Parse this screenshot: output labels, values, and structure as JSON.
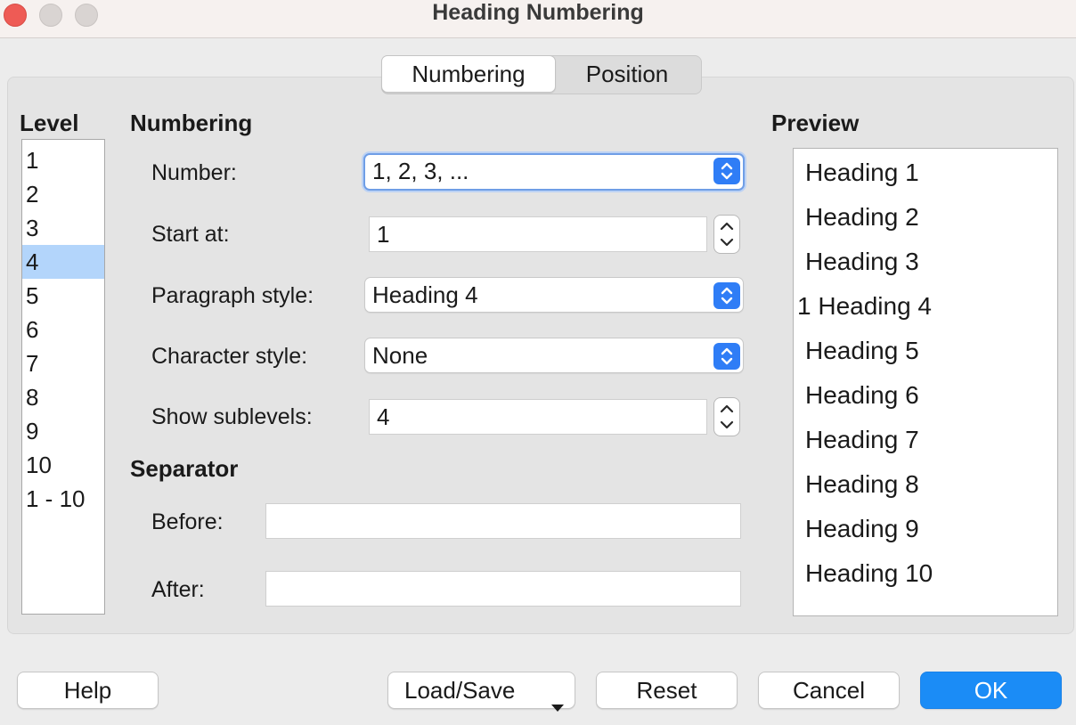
{
  "window": {
    "title": "Heading Numbering"
  },
  "tabs": [
    {
      "label": "Numbering",
      "selected": true
    },
    {
      "label": "Position",
      "selected": false
    }
  ],
  "level": {
    "heading": "Level",
    "items": [
      "1",
      "2",
      "3",
      "4",
      "5",
      "6",
      "7",
      "8",
      "9",
      "10",
      "1 - 10"
    ],
    "selected_index": 3
  },
  "numbering": {
    "heading": "Numbering",
    "number_label": "Number:",
    "number_value": "1, 2, 3, ...",
    "start_label": "Start at:",
    "start_value": "1",
    "para_label": "Paragraph style:",
    "para_value": "Heading 4",
    "char_label": "Character style:",
    "char_value": "None",
    "sublevels_label": "Show sublevels:",
    "sublevels_value": "4"
  },
  "separator": {
    "heading": "Separator",
    "before_label": "Before:",
    "before_value": "",
    "after_label": "After:",
    "after_value": ""
  },
  "preview": {
    "heading": "Preview",
    "items": [
      "Heading 1",
      "Heading 2",
      "Heading 3",
      "1 Heading 4",
      "Heading 5",
      "Heading 6",
      "Heading 7",
      "Heading 8",
      "Heading 9",
      "Heading 10"
    ]
  },
  "buttons": {
    "help": "Help",
    "load_save": "Load/Save",
    "reset": "Reset",
    "cancel": "Cancel",
    "ok": "OK"
  },
  "colors": {
    "accent": "#2f7df6",
    "ok_button": "#1b8cf6",
    "selection": "#b3d5fb",
    "close_button": "#ee5b55"
  }
}
